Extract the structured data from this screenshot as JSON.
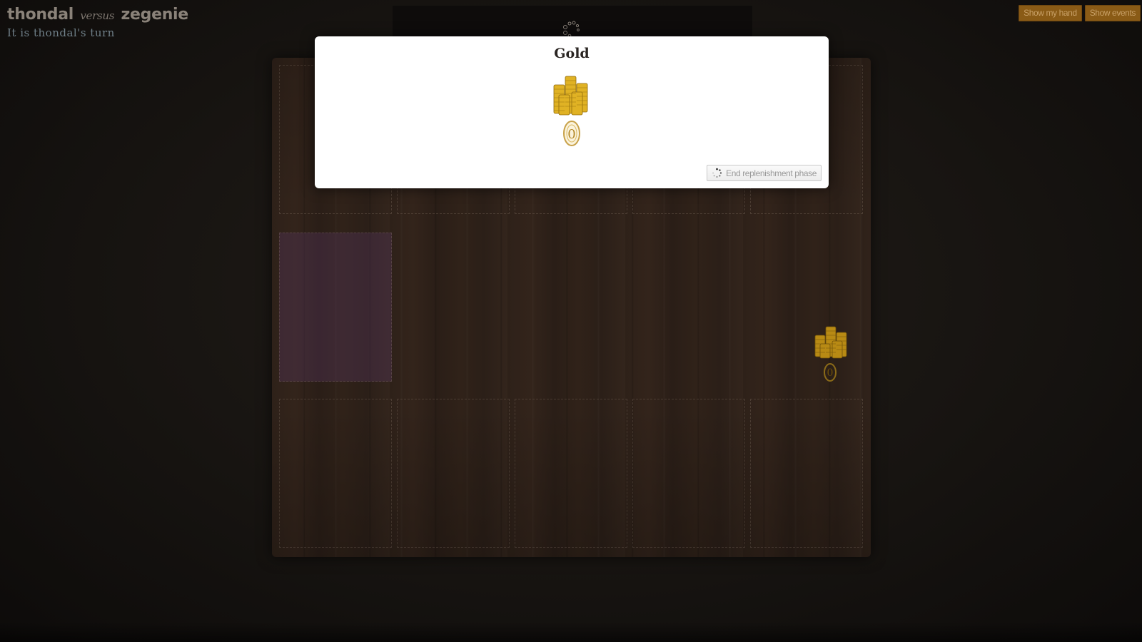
{
  "header": {
    "player1": "thondal",
    "versus": "versus",
    "player2": "zegenie",
    "turn_text": "It is thondal's turn"
  },
  "top_buttons": {
    "show_hand": "Show my hand",
    "show_events": "Show events"
  },
  "modal": {
    "title": "Gold",
    "coin_count": "0",
    "end_button_label": "End replenishment phase",
    "icons": [
      "gold-coins-icon",
      "loading-spinner-icon"
    ]
  },
  "board": {
    "side_gold_count": "0"
  },
  "colors": {
    "button_bg": "#8a5b16",
    "button_text": "#c9a168",
    "gold": "#d6a21e",
    "slot_highlight": "#5f3c6e"
  }
}
